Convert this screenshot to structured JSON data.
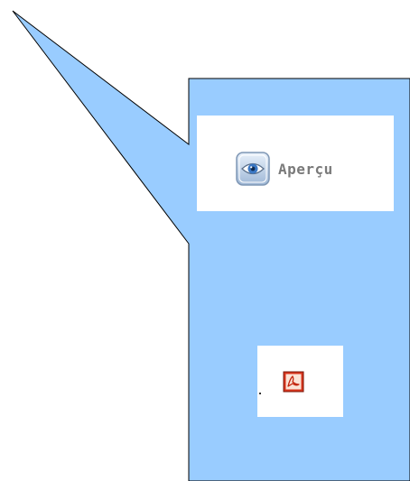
{
  "callout": {
    "fill_color": "#99ccff",
    "stroke_color": "#000000"
  },
  "preview": {
    "label": "Aperçu",
    "icon": "eye-icon"
  },
  "pdf": {
    "icon": "pdf-icon",
    "icon_color": "#d8341c"
  }
}
